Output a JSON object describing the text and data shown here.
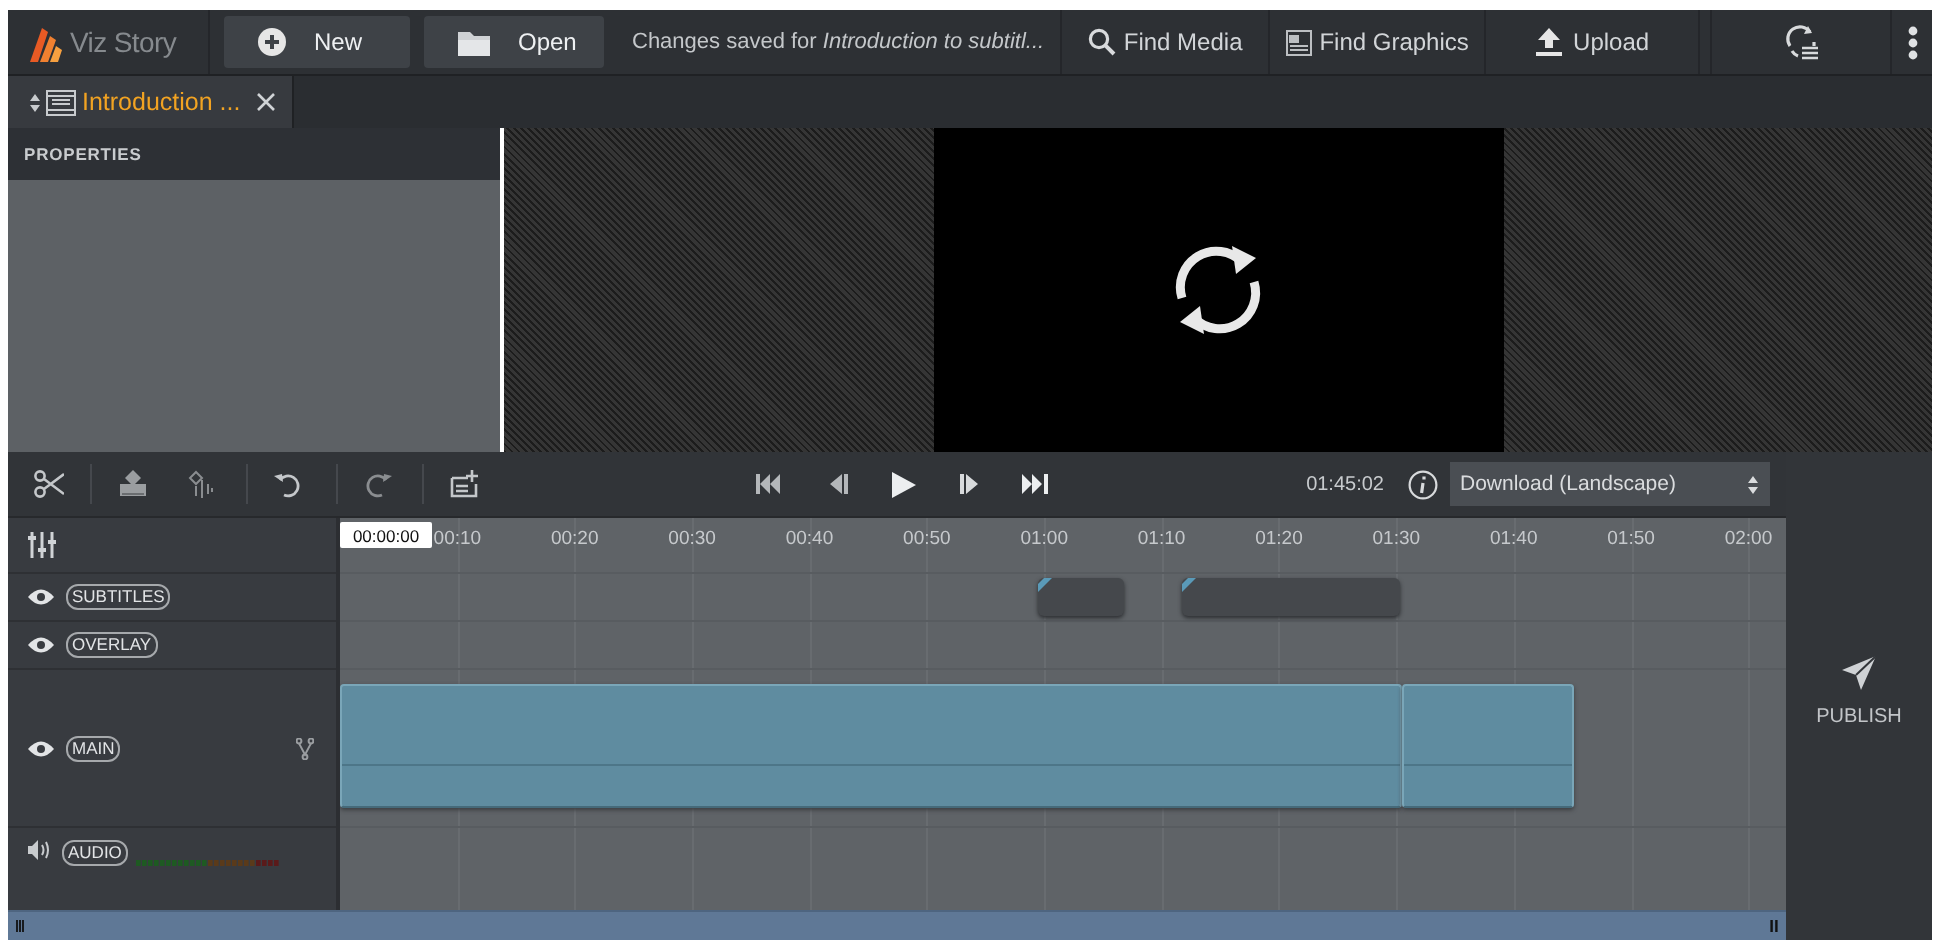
{
  "app": {
    "name": "Viz Story"
  },
  "toolbar": {
    "buttons": [
      {
        "label": "New",
        "kind": "new"
      },
      {
        "label": "Open",
        "kind": "open"
      }
    ],
    "status": "Changes saved for *Introduction to subtitl...*",
    "actions": [
      {
        "label": "Find Media",
        "kind": "search"
      },
      {
        "label": "Find Graphics",
        "kind": "graphics"
      },
      {
        "label": "Upload",
        "kind": "upload"
      }
    ]
  },
  "document_tabs": [
    {
      "label": "Introduction ...",
      "selected": true
    }
  ],
  "properties": {
    "title": "PROPERTIES"
  },
  "controls": {
    "duration": "01:45:02",
    "output": "Download (Landscape)"
  },
  "timeline": {
    "playhead": "00:00:00",
    "ticks": [
      "00:10",
      "00:20",
      "00:30",
      "00:40",
      "00:50",
      "01:00",
      "01:10",
      "01:20",
      "01:30",
      "01:40",
      "01:50",
      "02:00"
    ],
    "tracks": [
      {
        "label": "SUBTITLES",
        "kind": "subtitles"
      },
      {
        "label": "OVERLAY",
        "kind": "overlay"
      },
      {
        "label": "MAIN",
        "kind": "main"
      },
      {
        "label": "AUDIO",
        "kind": "audio"
      }
    ]
  },
  "publish": {
    "label": "PUBLISH"
  }
}
